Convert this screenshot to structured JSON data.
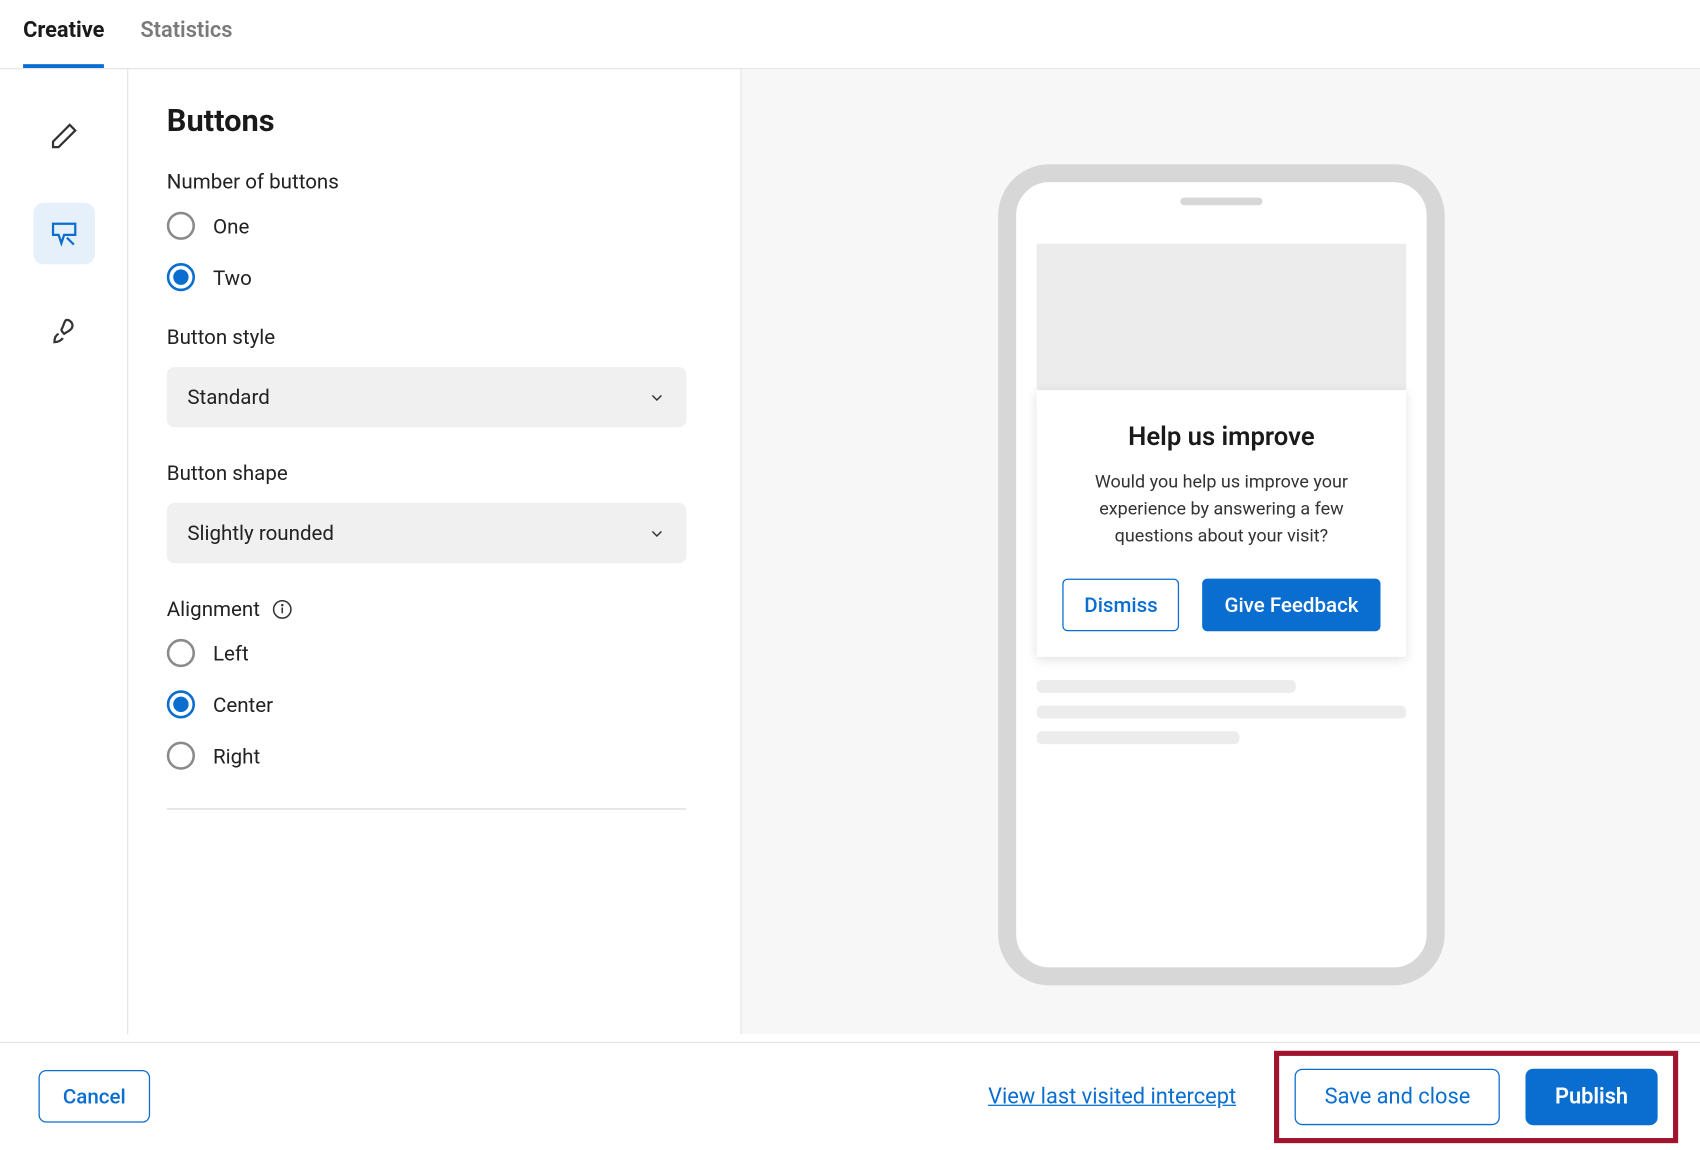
{
  "tabs": {
    "creative": "Creative",
    "statistics": "Statistics"
  },
  "panel": {
    "title": "Buttons",
    "number_label": "Number of buttons",
    "number_options": {
      "one": "One",
      "two": "Two"
    },
    "style_label": "Button style",
    "style_value": "Standard",
    "shape_label": "Button shape",
    "shape_value": "Slightly rounded",
    "alignment_label": "Alignment",
    "alignment_options": {
      "left": "Left",
      "center": "Center",
      "right": "Right"
    }
  },
  "preview": {
    "card_title": "Help us improve",
    "card_body": "Would you help us improve your experience by answering a few questions about your visit?",
    "dismiss": "Dismiss",
    "give_feedback": "Give Feedback"
  },
  "footer": {
    "cancel": "Cancel",
    "link": "View last visited intercept",
    "save_close": "Save and close",
    "publish": "Publish"
  }
}
